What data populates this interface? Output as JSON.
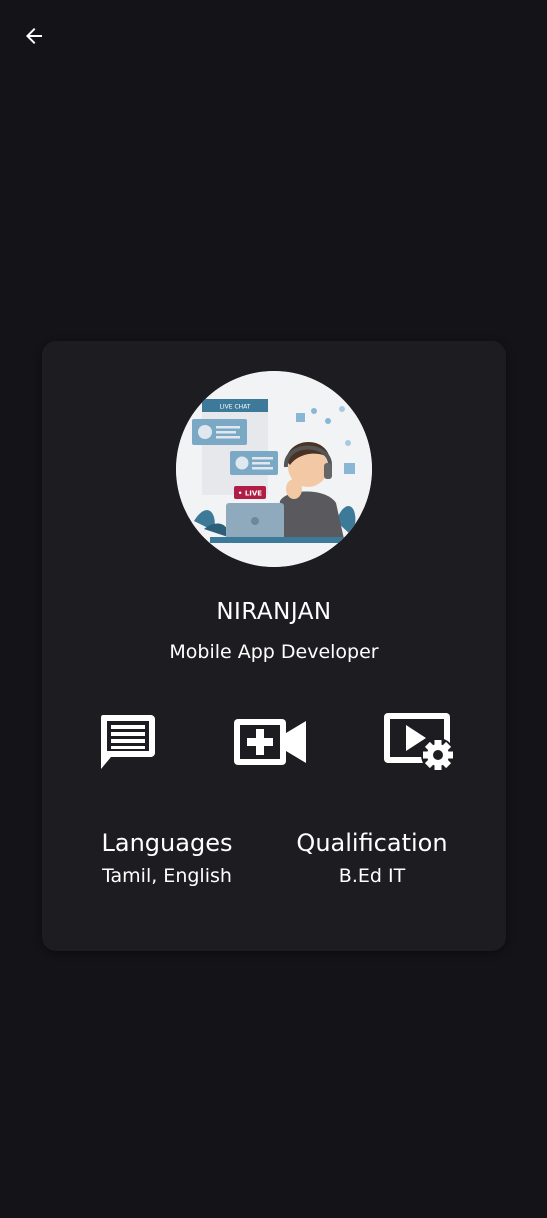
{
  "header": {
    "back_icon": "arrow-left-icon"
  },
  "profile": {
    "avatar_badge_live_chat": "LIVE CHAT",
    "avatar_badge_live": "• LIVE",
    "name": "NIRANJAN",
    "role": "Mobile App Developer"
  },
  "actions": [
    {
      "icon": "chat-icon"
    },
    {
      "icon": "add-video-icon"
    },
    {
      "icon": "video-settings-icon"
    }
  ],
  "details": {
    "languages_label": "Languages",
    "languages_value": "Tamil, English",
    "qualification_label": "Qualification",
    "qualification_value": "B.Ed IT"
  },
  "colors": {
    "background": "#141318",
    "card": "#1d1c21",
    "text": "#ffffff"
  }
}
